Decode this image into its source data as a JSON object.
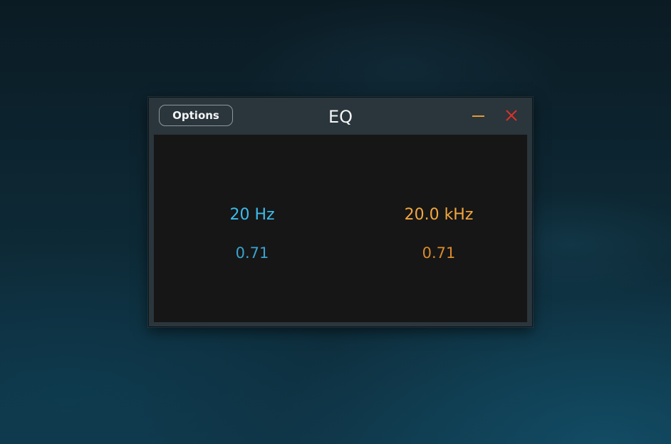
{
  "window": {
    "title": "EQ",
    "options_label": "Options"
  },
  "bands": {
    "low": {
      "frequency": "20 Hz",
      "q": "0.71"
    },
    "high": {
      "frequency": "20.0 kHz",
      "q": "0.71"
    }
  },
  "icons": {
    "minimize": "minimize-icon",
    "close": "close-icon"
  },
  "colors": {
    "low_band": "#3cbcec",
    "high_band": "#f3a63e",
    "minimize": "#e39a34",
    "close": "#d8322a",
    "panel_background": "#161616",
    "window_frame": "#2b353c"
  }
}
